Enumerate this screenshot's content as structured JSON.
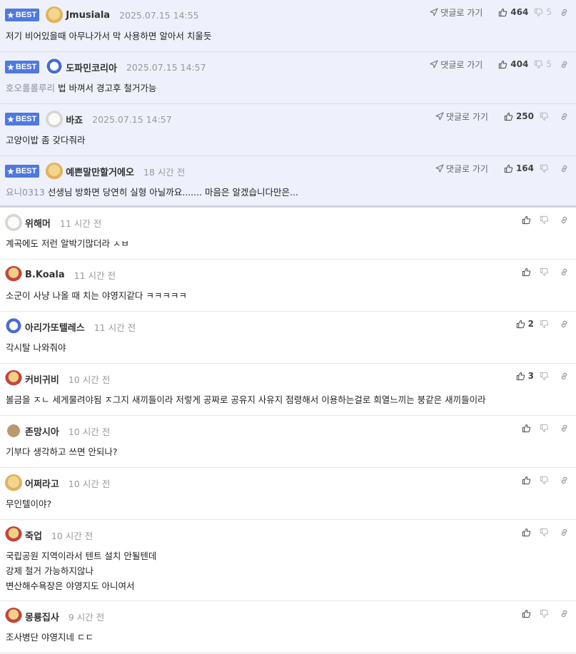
{
  "best_label": "BEST",
  "reply_label": "댓글로 가기",
  "comments": [
    {
      "best": true,
      "nickname": "Jmusiala",
      "time": "2025.07.15 14:55",
      "reply": true,
      "likes": "464",
      "dislikes": "5",
      "quote": "",
      "text": "저기 비어있을때 아무나가서 막 사용하면 알아서 치울듯",
      "avatar": "dog"
    },
    {
      "best": true,
      "nickname": "도파민코리아",
      "time": "2025.07.15 14:57",
      "reply": true,
      "likes": "404",
      "dislikes": "5",
      "quote": "호오롤롤루리",
      "text": "법 바껴서 경고후 철거가능",
      "avatar": "blue"
    },
    {
      "best": true,
      "nickname": "바죠",
      "time": "2025.07.15 14:57",
      "reply": true,
      "likes": "250",
      "dislikes": "",
      "quote": "",
      "text": "고양이밥 좀 갖다줘라",
      "avatar": "white"
    },
    {
      "best": true,
      "nickname": "예쁜말만할거에오",
      "time": "18 시간 전",
      "reply": true,
      "likes": "164",
      "dislikes": "",
      "quote": "요니0313",
      "text": "선생님 방화면 당연히 실형 아닐까요....... 마음은 알겠습니다만은...",
      "avatar": "dog"
    },
    {
      "best": false,
      "nickname": "위해머",
      "time": "11 시간 전",
      "likes": "",
      "text": "계곡에도 저런 알박기많더라 ㅅㅂ",
      "avatar": "white"
    },
    {
      "best": false,
      "nickname": "B.Koala",
      "time": "11 시간 전",
      "likes": "",
      "text": "소군이 사냥 나올 때 치는 야영지같다 ㅋㅋㅋㅋㅋ",
      "avatar": "dogred"
    },
    {
      "best": false,
      "nickname": "아리가또텔레스",
      "time": "11 시간 전",
      "likes": "2",
      "text": "각시탈 나와줘야",
      "avatar": "blue"
    },
    {
      "best": false,
      "nickname": "커비귀비",
      "time": "10 시간 전",
      "likes": "3",
      "text": "볼금을 ㅈㄴ 세게물려야됨 ㅈ그지 새끼들이라 저렇게 공짜로 공유지 사유지 점령해서 이용하는걸로 희열느끼는 붕같은 새끼들이라",
      "avatar": "dogred"
    },
    {
      "best": false,
      "nickname": "존망시아",
      "time": "10 시간 전",
      "likes": "",
      "text": "기부다 생각하고 쓰면 안되나?",
      "avatar": "brown"
    },
    {
      "best": false,
      "nickname": "어쩌라고",
      "time": "10 시간 전",
      "likes": "",
      "text": "무인텔이야?",
      "avatar": "dog"
    },
    {
      "best": false,
      "nickname": "죽업",
      "time": "10 시간 전",
      "likes": "",
      "text": "국립공원 지역이라서 텐트 설치 안될텐데\n강제 철거 가능하지않나\n변산해수욕장은 야영지도 아니여서",
      "avatar": "dogred",
      "tall": true
    },
    {
      "best": false,
      "nickname": "몽룡집사",
      "time": "9 시간 전",
      "likes": "",
      "text": "조사병단 야영지네 ㄷㄷ",
      "avatar": "dogred"
    }
  ]
}
